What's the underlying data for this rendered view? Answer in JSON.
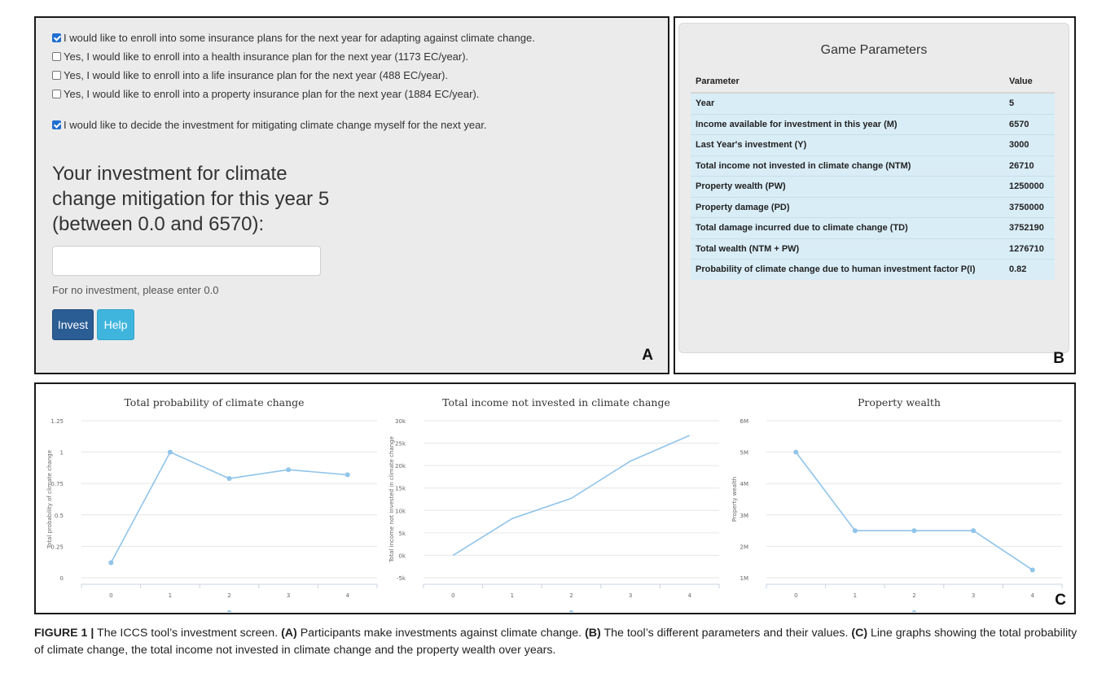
{
  "panel_a": {
    "checkboxes": [
      {
        "checked": true,
        "label": "I would like to enroll into some insurance plans for the next year for adapting against climate change."
      },
      {
        "checked": false,
        "label": "Yes, I would like to enroll into a health insurance plan for the next year (1173 EC/year)."
      },
      {
        "checked": false,
        "label": "Yes, I would like to enroll into a life insurance plan for the next year (488 EC/year)."
      },
      {
        "checked": false,
        "label": "Yes, I would like to enroll into a property insurance plan for the next year (1884 EC/year)."
      },
      {
        "checked": true,
        "label": "I would like to decide the investment for mitigating climate change myself for the next year."
      }
    ],
    "question": "Your investment for climate change mitigation for this year 5 (between 0.0 and 6570):",
    "input_value": "",
    "hint": "For no investment, please enter 0.0",
    "invest_label": "Invest",
    "help_label": "Help",
    "letter": "A"
  },
  "panel_b": {
    "title": "Game Parameters",
    "header_param": "Parameter",
    "header_value": "Value",
    "rows": [
      [
        "Year",
        "5"
      ],
      [
        "Income available for investment in this year (M)",
        "6570"
      ],
      [
        "Last Year's investment (Y)",
        "3000"
      ],
      [
        "Total income not invested in climate change (NTM)",
        "26710"
      ],
      [
        "Property wealth (PW)",
        "1250000"
      ],
      [
        "Property damage (PD)",
        "3750000"
      ],
      [
        "Total damage incurred due to climate change (TD)",
        "3752190"
      ],
      [
        "Total wealth (NTM + PW)",
        "1276710"
      ],
      [
        "Probability of climate change due to human investment factor P(I)",
        "0.82"
      ]
    ],
    "letter": "B"
  },
  "panel_c": {
    "letter": "C"
  },
  "chart_data": [
    {
      "type": "line",
      "title": "Total probability of climate change",
      "ylabel": "Total probability of climate change",
      "x": [
        0,
        1,
        2,
        3,
        4
      ],
      "values": [
        0.12,
        1.0,
        0.79,
        0.86,
        0.82
      ],
      "ylim": [
        0,
        1.25
      ],
      "yticks": [
        "0",
        "0.25",
        "0.5",
        "0.75",
        "1",
        "1.25"
      ],
      "ytick_values": [
        0,
        0.25,
        0.5,
        0.75,
        1,
        1.25
      ],
      "xticks": [
        "0",
        "1",
        "2",
        "3",
        "4"
      ],
      "markers": "all",
      "color": "#90c4ea",
      "grid": true
    },
    {
      "type": "line",
      "title": "Total income not invested in climate change",
      "ylabel": "Total income not invested in climate change",
      "x": [
        0,
        1,
        2,
        3,
        4
      ],
      "values": [
        0,
        8200,
        12700,
        21000,
        26710
      ],
      "ylim": [
        -5000,
        30000
      ],
      "yticks": [
        "-5k",
        "0k",
        "5k",
        "10k",
        "15k",
        "20k",
        "25k",
        "30k"
      ],
      "ytick_values": [
        -5000,
        0,
        5000,
        10000,
        15000,
        20000,
        25000,
        30000
      ],
      "xticks": [
        "0",
        "1",
        "2",
        "3",
        "4"
      ],
      "markers": "none",
      "color": "#90c4ea",
      "grid": true
    },
    {
      "type": "line",
      "title": "Property wealth",
      "ylabel": "Property wealth",
      "x": [
        0,
        1,
        2,
        3,
        4
      ],
      "values": [
        5000000,
        2500000,
        2500000,
        2500000,
        1250000
      ],
      "ylim": [
        1000000,
        6000000
      ],
      "yticks": [
        "1M",
        "2M",
        "3M",
        "4M",
        "5M",
        "6M"
      ],
      "ytick_values": [
        1000000,
        2000000,
        3000000,
        4000000,
        5000000,
        6000000
      ],
      "xticks": [
        "0",
        "1",
        "2",
        "3",
        "4"
      ],
      "markers": "all",
      "color": "#90c4ea",
      "grid": true
    }
  ],
  "caption": {
    "fig_label": "FIGURE 1 |",
    "intro": " The ICCS tool’s investment screen. ",
    "a_label": "(A)",
    "a_text": " Participants make investments against climate change. ",
    "b_label": "(B)",
    "b_text": " The tool’s different parameters and their values. ",
    "c_label": "(C)",
    "c_text": " Line graphs showing the total probability of climate change, the total income not invested in climate change and the property wealth over years."
  }
}
